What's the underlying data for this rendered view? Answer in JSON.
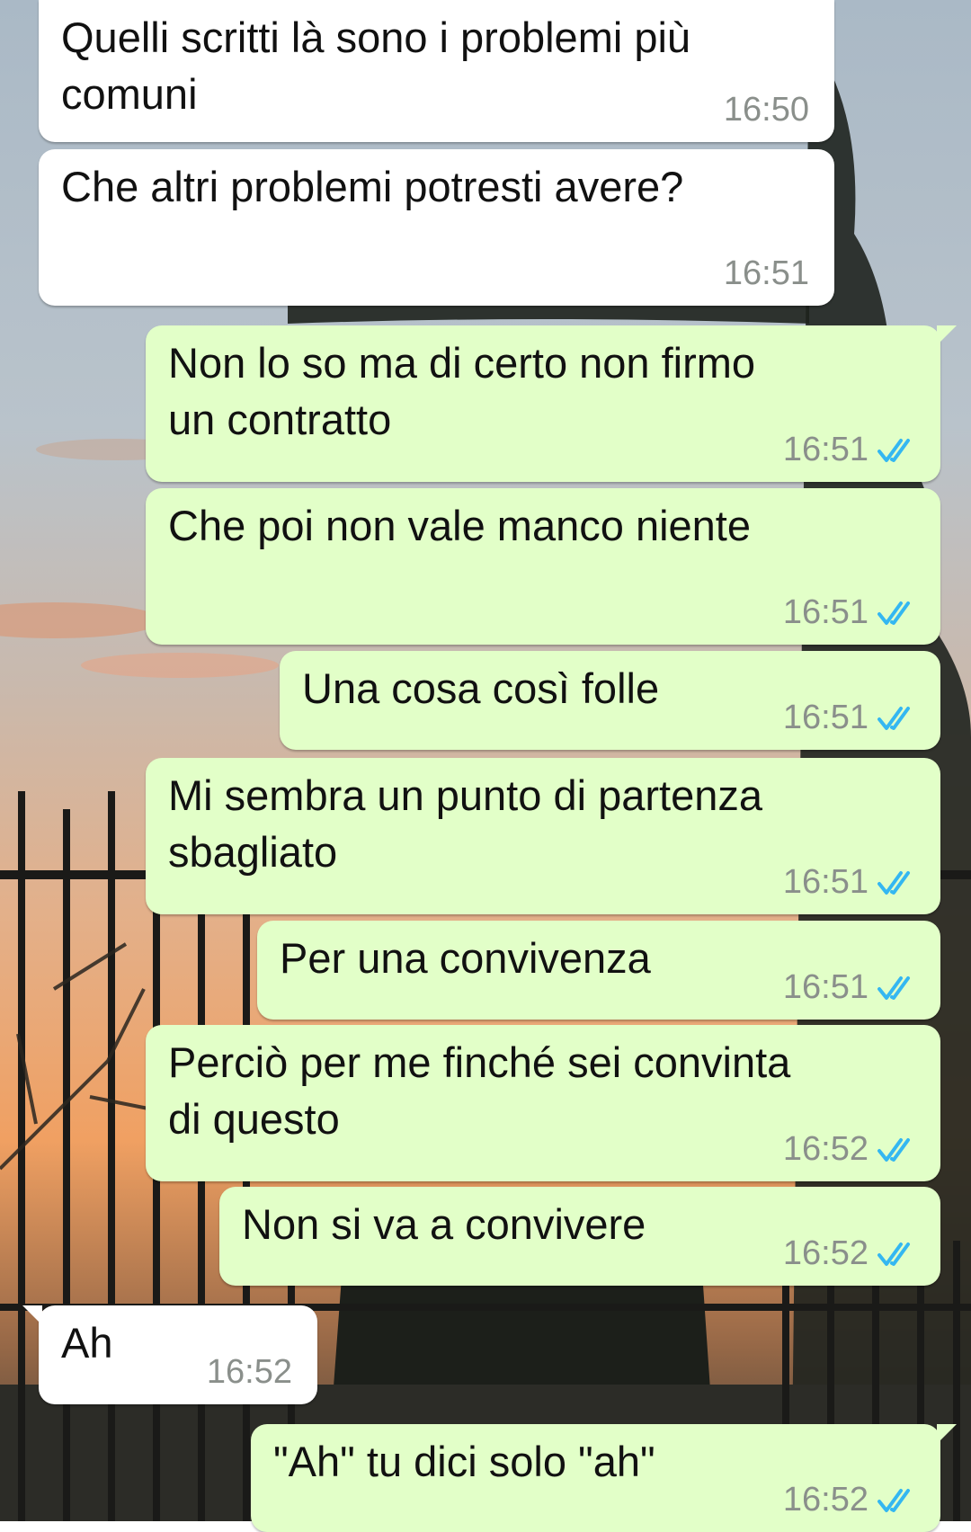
{
  "conversation": {
    "messages": [
      {
        "dir": "in",
        "text": "Quelli scritti là sono i problemi più\ncomuni",
        "time": "16:50"
      },
      {
        "dir": "in",
        "text": "Che altri problemi potresti avere?",
        "time": "16:51"
      },
      {
        "dir": "out",
        "text": "Non lo so ma di certo non firmo\nun contratto",
        "time": "16:51",
        "status": "read"
      },
      {
        "dir": "out",
        "text": "Che poi non vale manco niente",
        "time": "16:51",
        "status": "read"
      },
      {
        "dir": "out",
        "text": "Una cosa così folle",
        "time": "16:51",
        "status": "read"
      },
      {
        "dir": "out",
        "text": "Mi sembra un punto di partenza\nsbagliato",
        "time": "16:51",
        "status": "read"
      },
      {
        "dir": "out",
        "text": "Per una convivenza",
        "time": "16:51",
        "status": "read"
      },
      {
        "dir": "out",
        "text": "Perciò per me finché sei convinta\ndi questo",
        "time": "16:52",
        "status": "read"
      },
      {
        "dir": "out",
        "text": "Non si va a convivere",
        "time": "16:52",
        "status": "read"
      },
      {
        "dir": "in",
        "text": "Ah",
        "time": "16:52"
      },
      {
        "dir": "out",
        "text": "\"Ah\" tu dici solo \"ah\"",
        "time": "16:52",
        "status": "read"
      }
    ]
  },
  "icons": {
    "read_receipt": "double-check-icon"
  },
  "colors": {
    "incoming_bubble": "#ffffff",
    "outgoing_bubble": "#e2ffc8",
    "read_tick": "#34b7f1",
    "timestamp": "#8a8f8b"
  }
}
